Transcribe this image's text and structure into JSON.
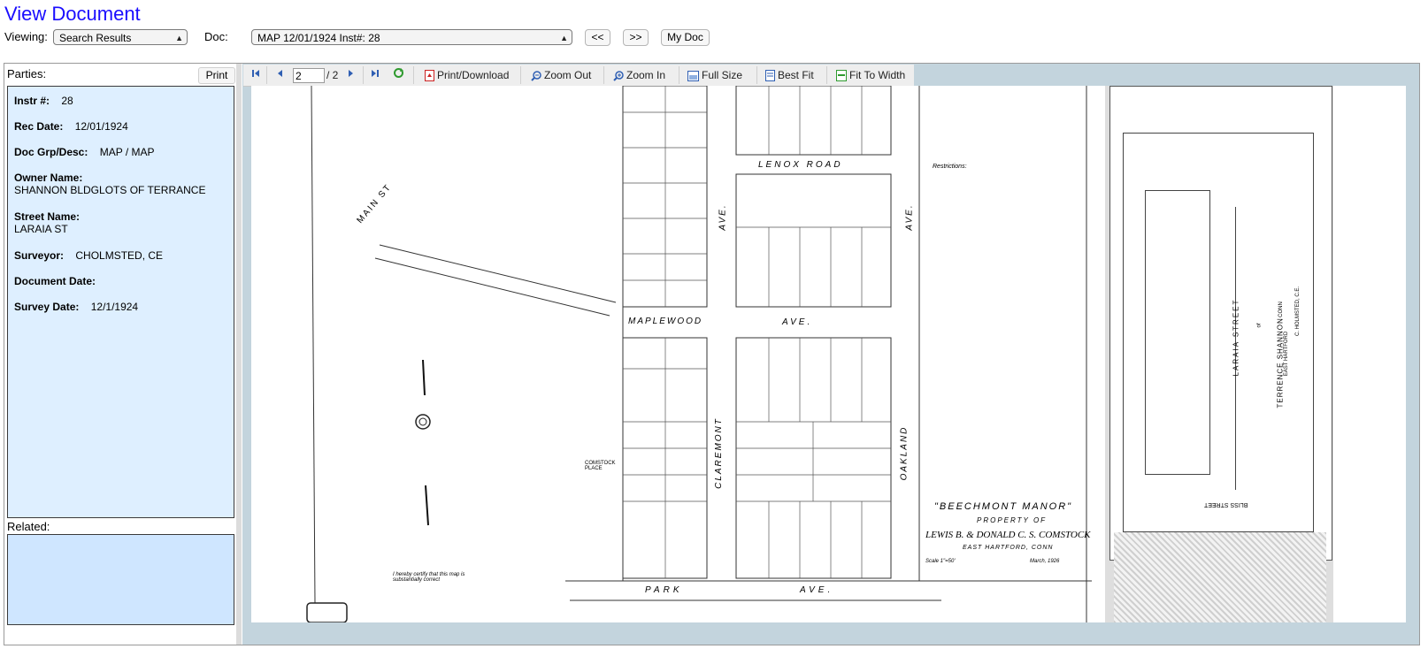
{
  "header": {
    "title": "View Document",
    "viewing_label": "Viewing:",
    "viewing_value": "Search Results",
    "doc_label": "Doc:",
    "doc_value": "MAP 12/01/1924 Inst#: 28",
    "prev_label": "<<",
    "next_label": ">>",
    "mydoc_label": "My Doc"
  },
  "left": {
    "parties_label": "Parties:",
    "print_label": "Print",
    "fields": {
      "instr_label": "Instr #:",
      "instr_value": "28",
      "rec_date_label": "Rec Date:",
      "rec_date_value": "12/01/1924",
      "doc_grp_label": "Doc Grp/Desc:",
      "doc_grp_value": "MAP / MAP",
      "owner_label": "Owner Name:",
      "owner_value": "SHANNON BLDGLOTS OF TERRANCE",
      "street_label": "Street Name:",
      "street_value": "LARAIA ST",
      "surveyor_label": "Surveyor:",
      "surveyor_value": "CHOLMSTED, CE",
      "doc_date_label": "Document Date:",
      "doc_date_value": "",
      "survey_date_label": "Survey Date:",
      "survey_date_value": "12/1/1924"
    },
    "related_label": "Related:"
  },
  "toolbar": {
    "page_value": "2",
    "page_total": "/ 2",
    "print_download": "Print/Download",
    "zoom_out": "Zoom Out",
    "zoom_in": "Zoom In",
    "full_size": "Full Size",
    "best_fit": "Best Fit",
    "fit_width": "Fit To Width"
  },
  "map": {
    "main_st": "MAIN ST",
    "lenox_road": "LENOX ROAD",
    "maplewood": "MAPLEWOOD",
    "ave_mid": "AVE.",
    "park": "PARK",
    "ave_bottom": "AVE.",
    "claremont": "CLAREMONT",
    "oakland": "OAKLAND",
    "ave_left": "AVE.",
    "ave_right": "AVE.",
    "title1": "\"BEECHMONT MANOR\"",
    "title2": "PROPERTY OF",
    "title3": "LEWIS B. & DONALD C. S. COMSTOCK",
    "title4": "EAST HARTFORD, CONN",
    "scale": "Scale 1\"=50'",
    "date": "March, 1926",
    "restrictions": "Restrictions:",
    "comstock_place": "COMSTOCK PLACE",
    "cert": "I hereby certify that this map is substantially correct",
    "laraia": "LARAIA STREET",
    "bliss": "BLISS STREET",
    "bldg_lots": "BUILDING LOTS",
    "of": "of",
    "terrence": "TERRENCE SHANNON",
    "conn": "CONN",
    "east_hartford": "EAST HARTFORD",
    "cholmsted": "C. HOLMSTED, C.E."
  }
}
